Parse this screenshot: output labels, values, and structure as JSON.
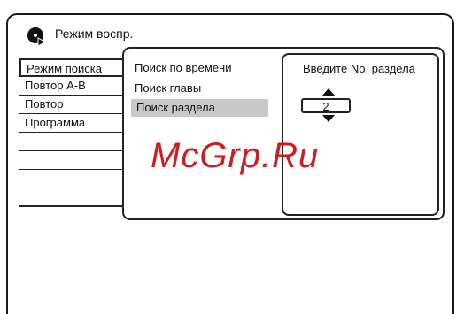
{
  "title": "Режим воспр.",
  "menu": {
    "items": [
      {
        "label": "Режим поиска"
      },
      {
        "label": "Повтор A-B"
      },
      {
        "label": "Повтор"
      },
      {
        "label": "Программа"
      }
    ]
  },
  "submenu": {
    "items": [
      {
        "label": "Поиск по времени"
      },
      {
        "label": "Поиск главы"
      },
      {
        "label": "Поиск раздела"
      }
    ]
  },
  "input": {
    "label": "Введите No. раздела",
    "value": "2"
  },
  "watermark": "McGrp.Ru"
}
